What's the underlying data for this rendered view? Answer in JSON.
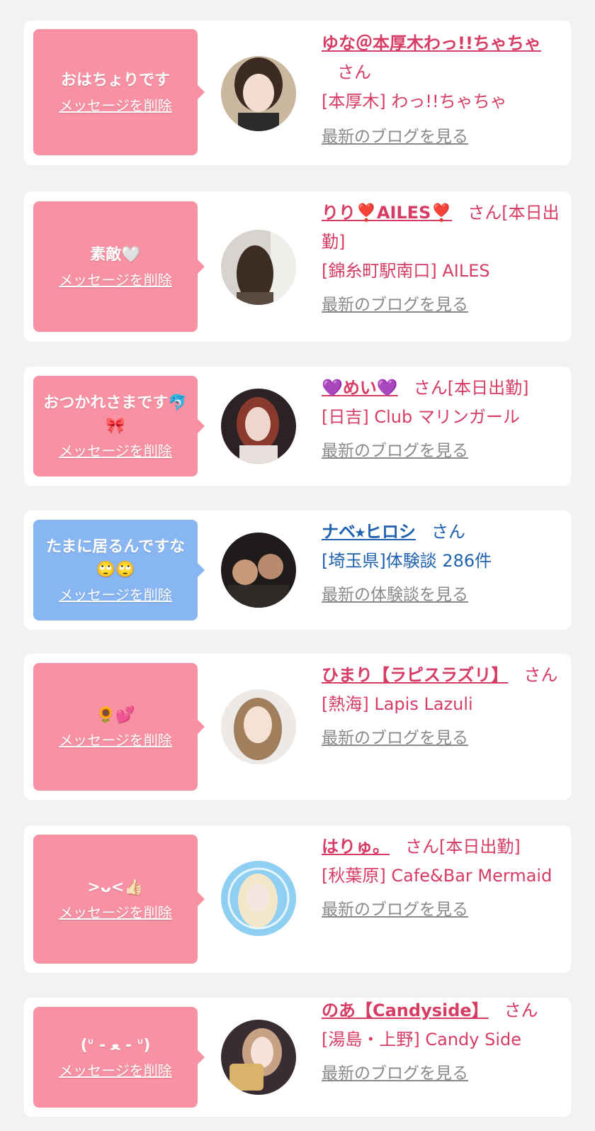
{
  "delete_label": "メッセージを削除",
  "colors": {
    "accent": "#d63c64",
    "bubble_pink": "#f891a3",
    "bubble_blue": "#88b6f3",
    "link_blue": "#1f62b0",
    "background": "#f2f2f2"
  },
  "items": [
    {
      "message": "おはちょりです",
      "name": "ゆな＠本厚木わっ!!ちゃちゃ",
      "suffix": "さん",
      "shop": "[本厚木] わっ!!ちゃちゃ",
      "link": "最新のブログを見る",
      "bubble_color": "pink",
      "avatar": "woman-dark-hair-portrait"
    },
    {
      "message": "素敵🤍",
      "name": "りり❣️AILES❣️",
      "suffix": "さん[本日出勤]",
      "shop": "[錦糸町駅南口] AILES",
      "link": "最新のブログを見る",
      "bubble_color": "pink",
      "avatar": "woman-back-view-long-hair"
    },
    {
      "message": "おつかれさまです🐬🎀",
      "name": "💜めい💜",
      "suffix": "さん[本日出勤]",
      "shop": "[日吉] Club マリンガール",
      "link": "最新のブログを見る",
      "bubble_color": "pink",
      "avatar": "woman-red-hair-portrait"
    },
    {
      "message": "たまに居るんですな🙄🙄",
      "name": "ナベ⭑ヒロシ",
      "suffix": "さん",
      "shop": "[埼玉県]体験談 286件",
      "link": "最新の体験談を見る",
      "bubble_color": "blue",
      "avatar": "group-photo-dark"
    },
    {
      "message": "🌻💕",
      "name": "ひまり【ラピスラズリ】",
      "suffix": "さん",
      "shop": "[熱海] Lapis Lazuli",
      "link": "最新のブログを見る",
      "bubble_color": "pink",
      "avatar": "woman-blonde-curly-hair"
    },
    {
      "message": ">ᴗ<👍🏻",
      "name": "はりゅ。",
      "suffix": "さん[本日出勤]",
      "shop": "[秋葉原] Cafe&Bar Mermaid",
      "link": "最新のブログを見る",
      "bubble_color": "pink",
      "avatar": "woman-blue-background"
    },
    {
      "message": "(ᐡ - ﻌ - ᐡ)",
      "name": "のあ【Candyside】",
      "suffix": "さん",
      "shop": "[湯島・上野] Candy Side",
      "link": "最新のブログを見る",
      "bubble_color": "pink",
      "avatar": "woman-with-food"
    }
  ]
}
